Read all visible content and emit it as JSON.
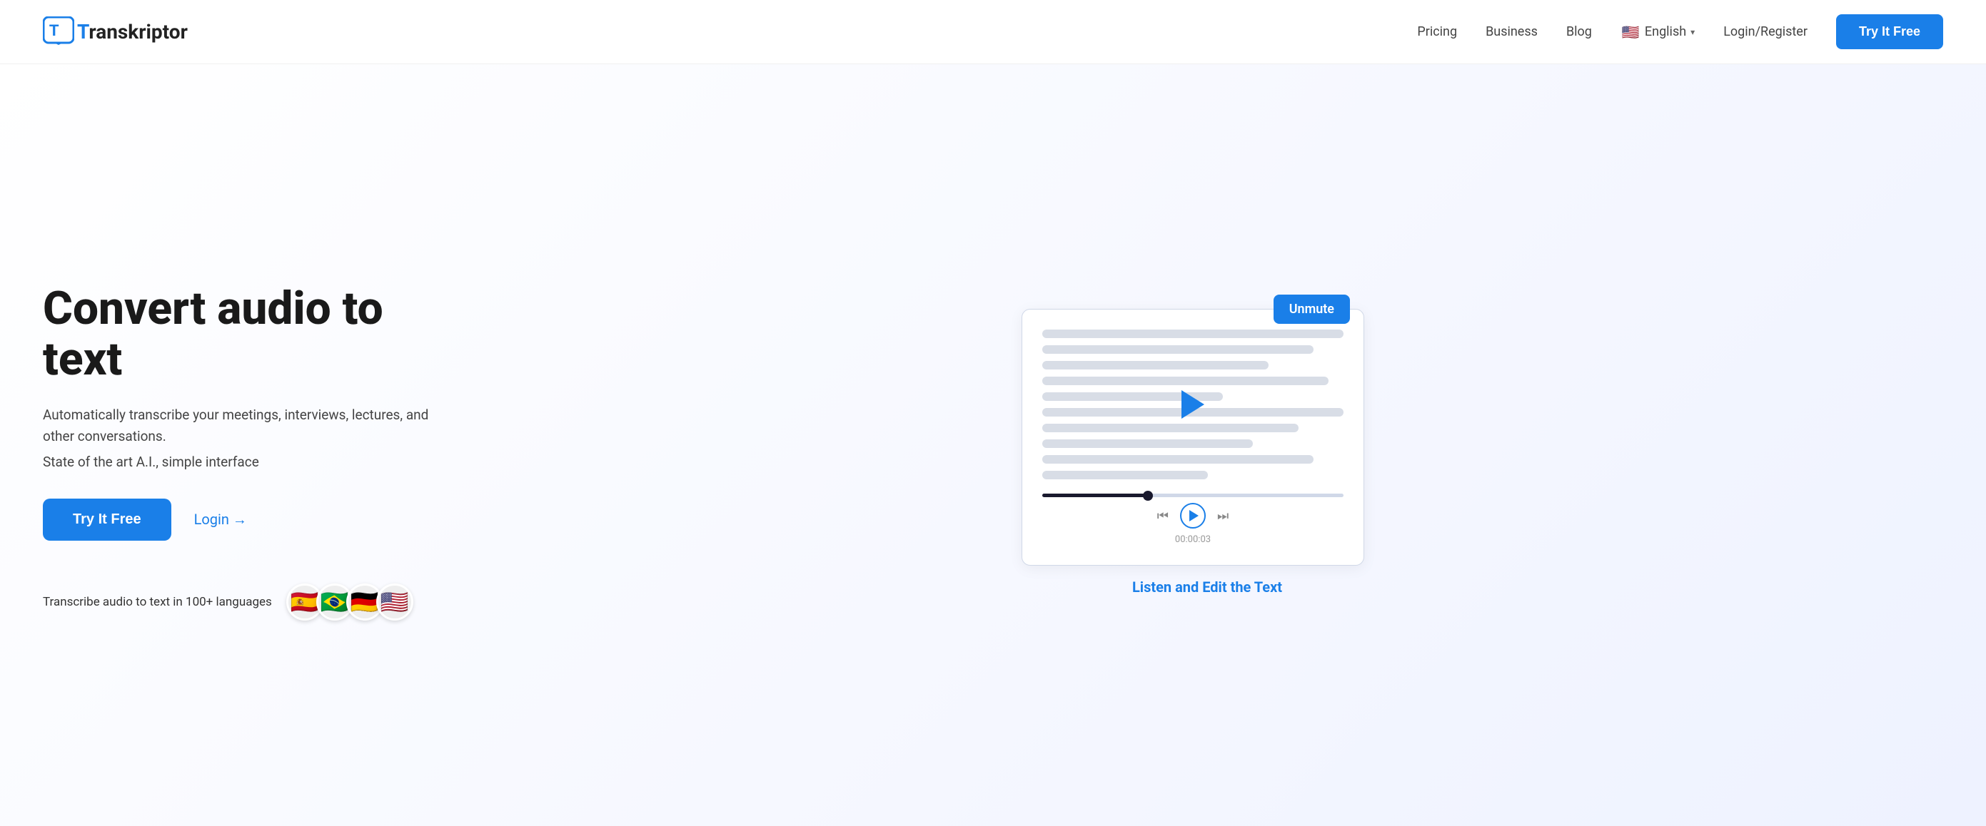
{
  "logo": {
    "letter": "T",
    "text_before": "",
    "text_after": "ranskriptor"
  },
  "nav": {
    "pricing_label": "Pricing",
    "business_label": "Business",
    "blog_label": "Blog",
    "language_label": "English",
    "language_flag": "🇺🇸",
    "login_label": "Login/Register",
    "cta_label": "Try It Free"
  },
  "hero": {
    "title": "Convert audio to text",
    "description": "Automatically transcribe your meetings, interviews, lectures, and other conversations.",
    "subtext": "State of the art A.I., simple interface",
    "try_button": "Try It Free",
    "login_link": "Login →",
    "languages_text": "Transcribe audio to text in 100+ languages",
    "flags": [
      "🇪🇸",
      "🇧🇷",
      "🇩🇪",
      "🇺🇸"
    ]
  },
  "illustration": {
    "unmute_label": "Unmute",
    "timestamp": "00:00:03",
    "listen_edit_label": "Listen and Edit the Text",
    "doc_lines": [
      {
        "width": "100%"
      },
      {
        "width": "90%"
      },
      {
        "width": "75%"
      },
      {
        "width": "95%"
      },
      {
        "width": "60%"
      },
      {
        "width": "100%"
      },
      {
        "width": "85%"
      },
      {
        "width": "70%"
      },
      {
        "width": "90%"
      },
      {
        "width": "55%"
      }
    ]
  },
  "colors": {
    "brand_blue": "#1a7fe8",
    "dark": "#1a1a1a",
    "text_gray": "#444"
  }
}
